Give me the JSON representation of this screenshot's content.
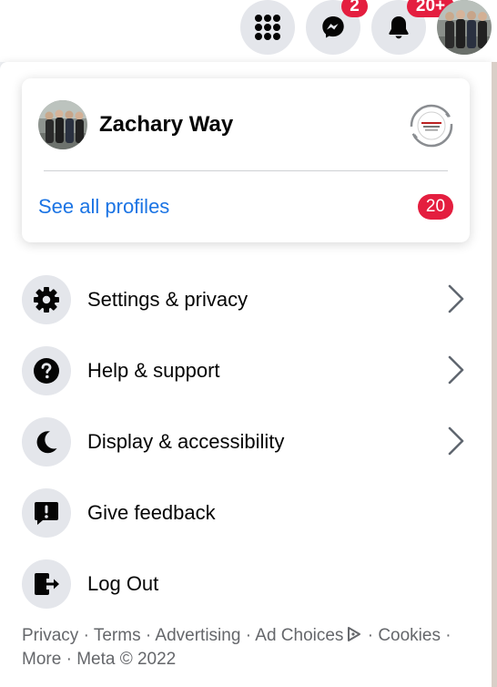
{
  "topbar": {
    "menu_icon": "grid-menu-icon",
    "messenger_icon": "messenger-icon",
    "messenger_badge": "2",
    "notifications_icon": "bell-icon",
    "notifications_badge": "20+",
    "account_avatar": "account-avatar"
  },
  "profile": {
    "name": "Zachary Way",
    "see_all_label": "See all profiles",
    "profile_count": "20",
    "switch_icon": "switch-profile-icon"
  },
  "menu": {
    "items": [
      {
        "label": "Settings & privacy",
        "icon": "gear-icon",
        "has_chevron": true
      },
      {
        "label": "Help & support",
        "icon": "question-icon",
        "has_chevron": true
      },
      {
        "label": "Display & accessibility",
        "icon": "moon-icon",
        "has_chevron": true
      },
      {
        "label": "Give feedback",
        "icon": "feedback-icon",
        "has_chevron": false
      },
      {
        "label": "Log Out",
        "icon": "logout-icon",
        "has_chevron": false
      }
    ]
  },
  "footer": {
    "privacy": "Privacy",
    "terms": "Terms",
    "advertising": "Advertising",
    "ad_choices": "Ad Choices",
    "cookies": "Cookies",
    "more": "More",
    "copyright": "Meta © 2022",
    "separator": " · "
  },
  "colors": {
    "accent": "#1b74e4",
    "badge": "#e41e3f",
    "icon_bg": "#e4e6eb",
    "text": "#050505",
    "muted": "#65676b"
  }
}
